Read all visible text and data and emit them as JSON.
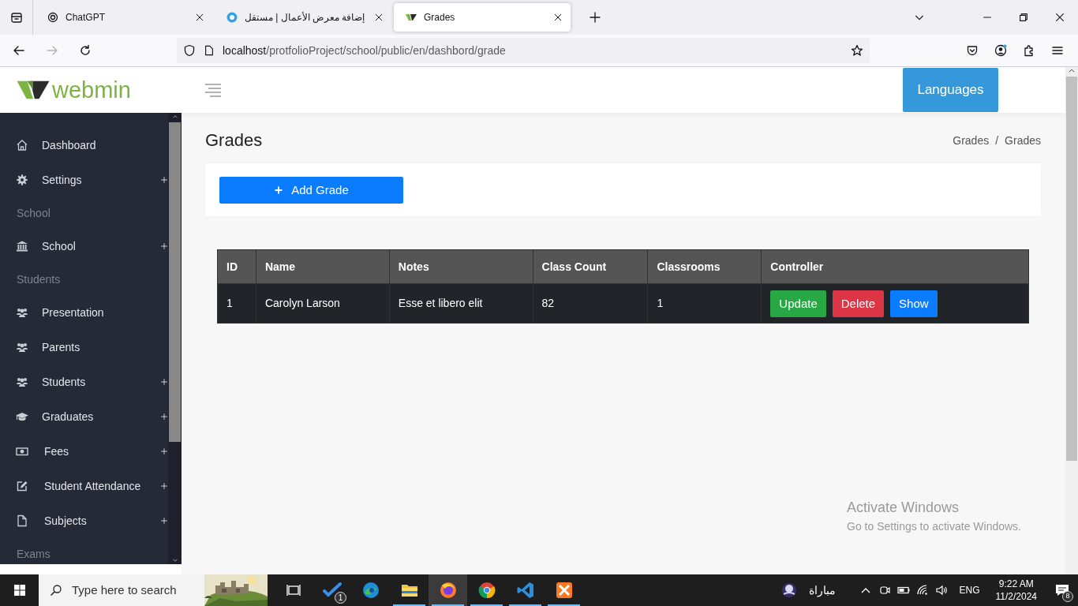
{
  "browser": {
    "tabs": [
      {
        "title": "ChatGPT",
        "selected": false
      },
      {
        "title": "إضافة معرض الأعمال | مستقل",
        "selected": false
      },
      {
        "title": "Grades",
        "selected": true
      }
    ],
    "nav": [
      {
        "kind": "back",
        "disabled": false
      },
      {
        "kind": "forward",
        "disabled": true
      },
      {
        "kind": "reload",
        "disabled": false
      }
    ],
    "address": {
      "host": "localhost",
      "path": "/protfolioProject/school/public/en/dashbord/grade"
    }
  },
  "app": {
    "logo": "webmin",
    "languages_button": "Languages",
    "sidebar": [
      {
        "kind": "item",
        "label": "Dashboard",
        "expandable": false
      },
      {
        "kind": "item",
        "label": "Settings",
        "expandable": true
      },
      {
        "kind": "header",
        "label": "School"
      },
      {
        "kind": "item",
        "label": "School",
        "expandable": true
      },
      {
        "kind": "header",
        "label": "Students"
      },
      {
        "kind": "item",
        "label": "Presentation",
        "expandable": false
      },
      {
        "kind": "item",
        "label": "Parents",
        "expandable": false
      },
      {
        "kind": "item",
        "label": "Students",
        "expandable": true
      },
      {
        "kind": "item",
        "label": "Graduates",
        "expandable": true
      },
      {
        "kind": "item",
        "label": "Fees",
        "expandable": true
      },
      {
        "kind": "item",
        "label": "Student Attendance",
        "expandable": true
      },
      {
        "kind": "item",
        "label": "Subjects",
        "expandable": true
      },
      {
        "kind": "header",
        "label": "Exams"
      }
    ],
    "page_title": "Grades",
    "breadcrumb": [
      "Grades",
      "Grades"
    ],
    "breadcrumb_separator": "/",
    "add_button": "Add Grade",
    "table": {
      "columns": [
        "ID",
        "Name",
        "Notes",
        "Class Count",
        "Classrooms",
        "Controller"
      ],
      "rows": [
        {
          "cells": [
            "1",
            "Carolyn Larson",
            "Esse et libero elit",
            "82",
            "1"
          ],
          "actions": [
            {
              "kind": "update",
              "label": "Update"
            },
            {
              "kind": "delete",
              "label": "Delete"
            },
            {
              "kind": "show",
              "label": "Show"
            }
          ]
        }
      ]
    }
  },
  "activation_notice": {
    "title": "Activate Windows",
    "subtitle": "Go to Settings to activate Windows."
  },
  "taskbar": {
    "search_placeholder": "Type here to search",
    "apps": [
      {
        "running": false,
        "selected": false,
        "badge": "1"
      },
      {
        "running": false,
        "selected": false
      },
      {
        "running": true,
        "selected": false
      },
      {
        "running": true,
        "selected": true
      },
      {
        "running": true,
        "selected": false
      },
      {
        "running": true,
        "selected": false
      },
      {
        "running": true,
        "selected": false
      }
    ],
    "weather_text": "مباراة",
    "language": "ENG",
    "time": "9:22 AM",
    "date": "11/2/2024",
    "notification_count": "8"
  }
}
